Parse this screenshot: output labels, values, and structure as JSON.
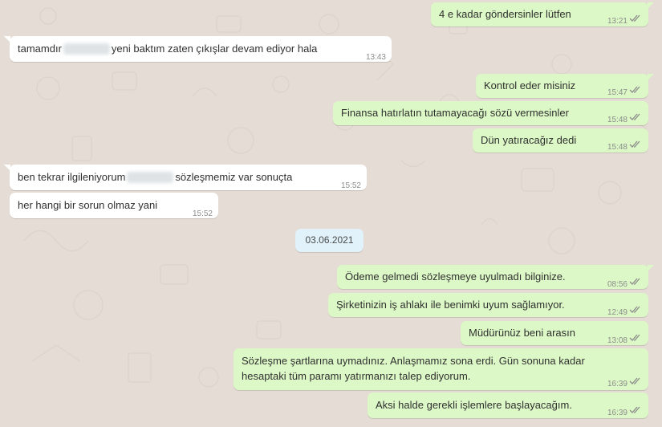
{
  "chat": {
    "date_separator": "03.06.2021",
    "messages": [
      {
        "direction": "out",
        "text": "4 e kadar göndersinler lütfen",
        "time": "13:21",
        "status": "read"
      },
      {
        "direction": "in",
        "text_before": "tamamdır",
        "text_after": "yeni baktım zaten çıkışlar devam ediyor hala",
        "time": "13:43",
        "has_redaction": true
      },
      {
        "direction": "out",
        "text": "Kontrol eder misiniz",
        "time": "15:47",
        "status": "read"
      },
      {
        "direction": "out",
        "text": "Finansa hatırlatın tutamayacağı sözü vermesinler",
        "time": "15:48",
        "status": "read"
      },
      {
        "direction": "out",
        "text": "Dün yatıracağız dedi",
        "time": "15:48",
        "status": "read"
      },
      {
        "direction": "in",
        "text_before": "ben tekrar ilgileniyorum",
        "text_after": "sözleşmemiz var sonuçta",
        "time": "15:52",
        "has_redaction": true
      },
      {
        "direction": "in",
        "text": "her hangi bir sorun olmaz yani",
        "time": "15:52"
      },
      {
        "direction": "out",
        "text": "Ödeme gelmedi sözleşmeye uyulmadı bilginize.",
        "time": "08:56",
        "status": "read"
      },
      {
        "direction": "out",
        "text": "Şirketinizin iş ahlakı ile benimki uyum sağlamıyor.",
        "time": "12:49",
        "status": "read"
      },
      {
        "direction": "out",
        "text": "Müdürünüz beni arasın",
        "time": "13:08",
        "status": "read"
      },
      {
        "direction": "out",
        "text_line1": "Sözleşme şartlarına uymadınız. Anlaşmamız sona erdi. Gün sonuna kadar",
        "text_line2": "hesaptaki tüm paramı yatırmanızı talep ediyorum.",
        "time": "16:39",
        "status": "read"
      },
      {
        "direction": "out",
        "text": "Aksi halde gerekli işlemlere başlayacağım.",
        "time": "16:39",
        "status": "read"
      }
    ]
  },
  "colors": {
    "background": "#e5ddd5",
    "incoming_bubble": "#ffffff",
    "outgoing_bubble": "#dcf8c6",
    "date_chip": "#e1f2fb",
    "timestamp": "#8c8c8c"
  },
  "icons": {
    "read_receipt": "double-check-icon"
  }
}
